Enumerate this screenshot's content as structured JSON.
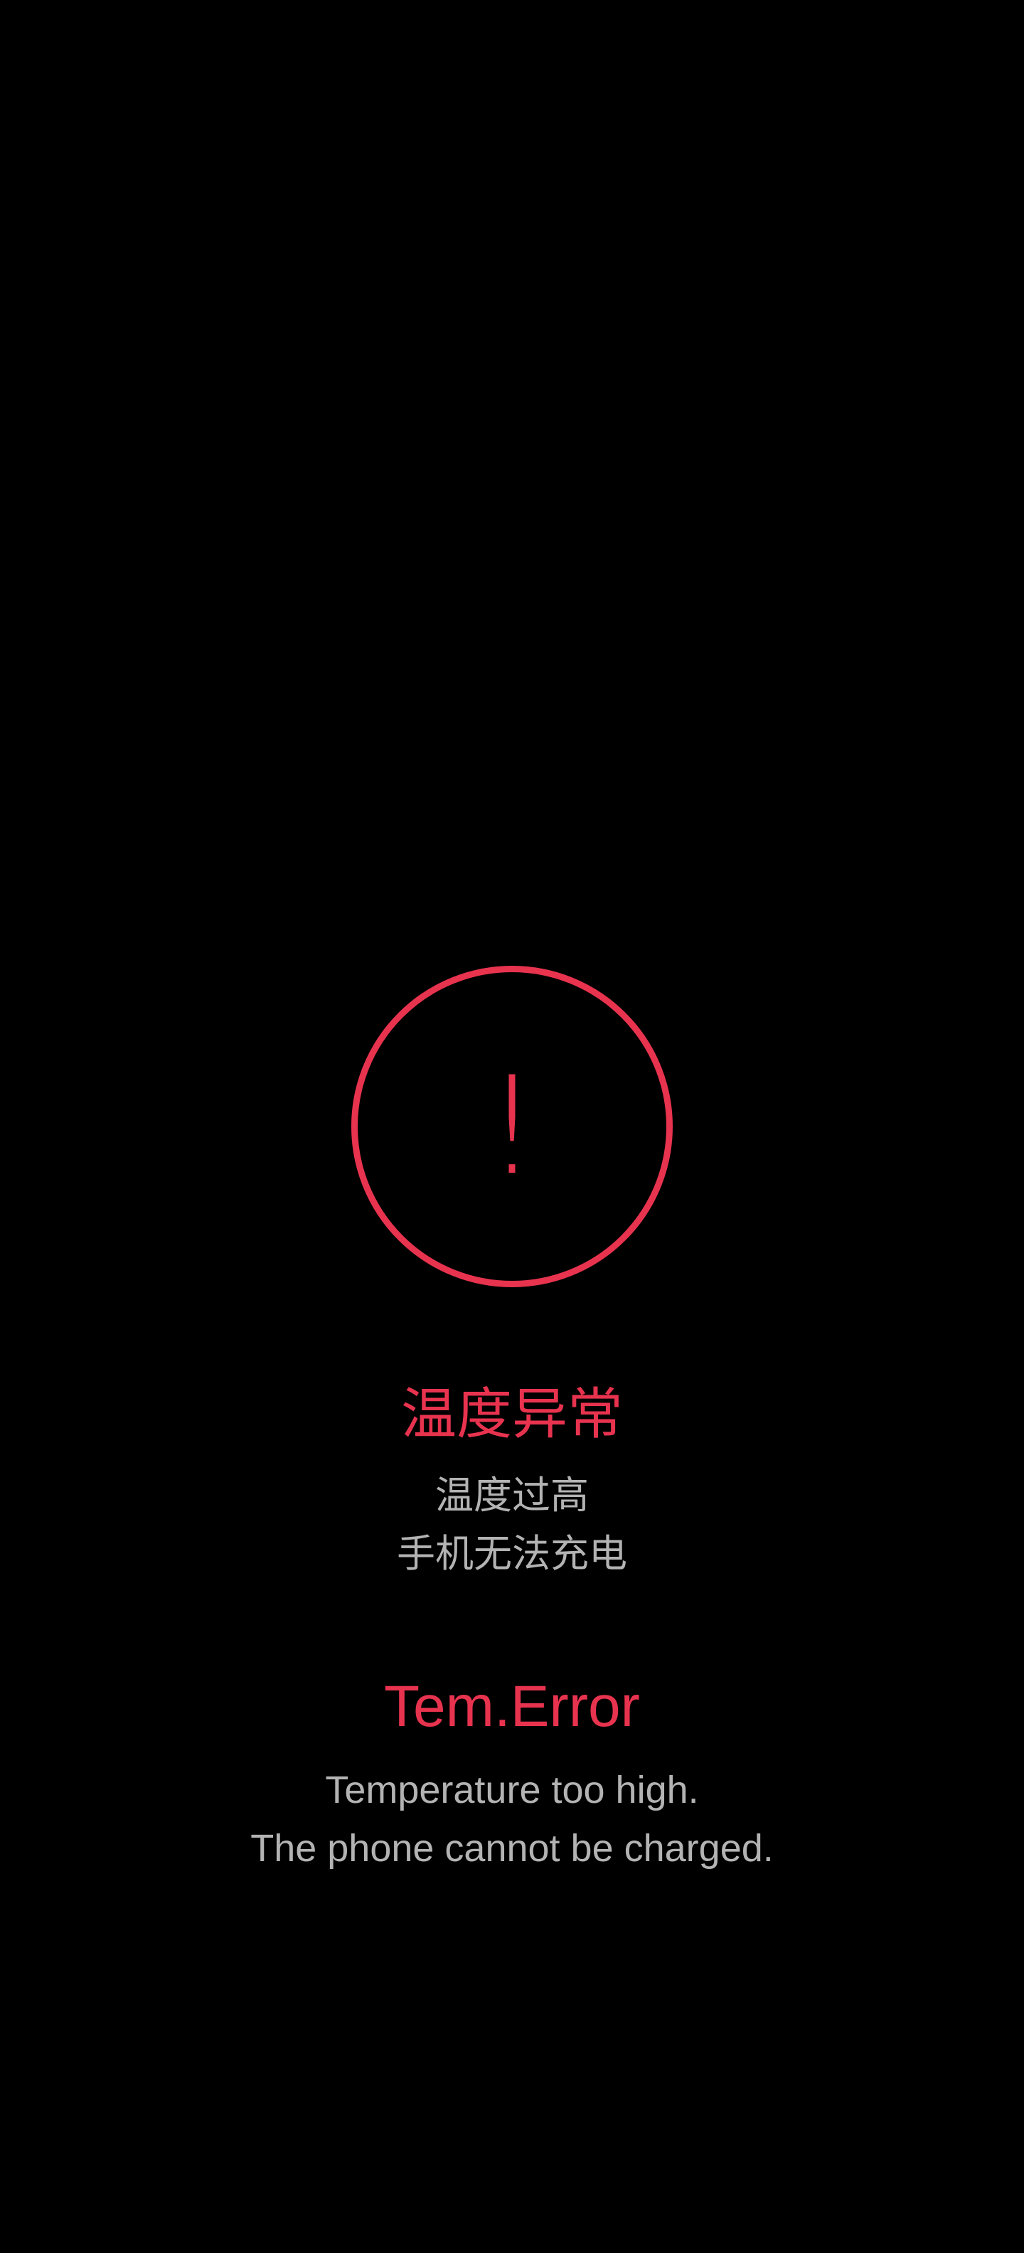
{
  "colors": {
    "background": "#000000",
    "accent": "#e8334f",
    "secondary_text": "#b3b3b3"
  },
  "alert": {
    "icon": "exclamation-circle-icon",
    "symbol": "!"
  },
  "chinese": {
    "title": "温度异常",
    "line1": "温度过高",
    "line2": "手机无法充电"
  },
  "english": {
    "title": "Tem.Error",
    "line1": "Temperature too high.",
    "line2": "The phone cannot be charged."
  }
}
